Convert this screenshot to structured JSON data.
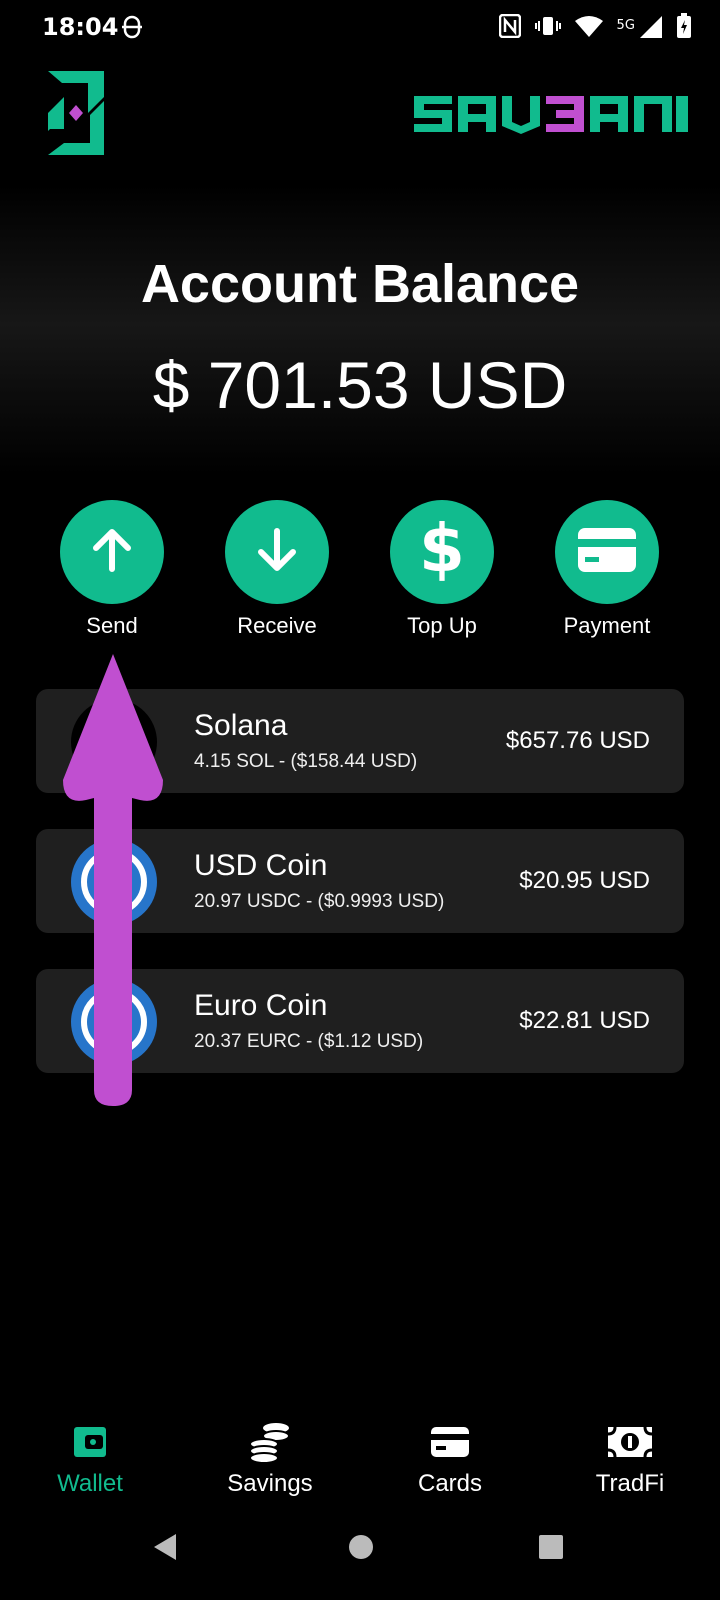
{
  "status_bar": {
    "time": "18:04",
    "network": "5G"
  },
  "brand": {
    "wordmark_parts": [
      "SAV",
      "3",
      "ANA"
    ]
  },
  "balance": {
    "title": "Account Balance",
    "amount": "$ 701.53 USD"
  },
  "actions": [
    {
      "label": "Send",
      "icon": "arrow-up-icon"
    },
    {
      "label": "Receive",
      "icon": "arrow-down-icon"
    },
    {
      "label": "Top Up",
      "icon": "dollar-icon"
    },
    {
      "label": "Payment",
      "icon": "card-icon"
    }
  ],
  "tokens": [
    {
      "name": "Solana",
      "detail": "4.15 SOL  -  ($158.44 USD)",
      "value": "$657.76 USD",
      "icon": "solana-icon"
    },
    {
      "name": "USD Coin",
      "detail": "20.97 USDC  -  ($0.9993 USD)",
      "value": "$20.95 USD",
      "icon": "usdc-icon"
    },
    {
      "name": "Euro Coin",
      "detail": "20.37 EURC  -  ($1.12 USD)",
      "value": "$22.81 USD",
      "icon": "eurc-icon"
    }
  ],
  "nav": [
    {
      "label": "Wallet",
      "icon": "wallet-icon",
      "active": true
    },
    {
      "label": "Savings",
      "icon": "coins-stack-icon",
      "active": false
    },
    {
      "label": "Cards",
      "icon": "card-icon",
      "active": false
    },
    {
      "label": "TradFi",
      "icon": "banknote-icon",
      "active": false
    }
  ],
  "colors": {
    "accent": "#11bb8e",
    "brand_purple": "#c04fd0",
    "card_bg": "#1f1f1f",
    "coin_blue": "#2775ca"
  }
}
